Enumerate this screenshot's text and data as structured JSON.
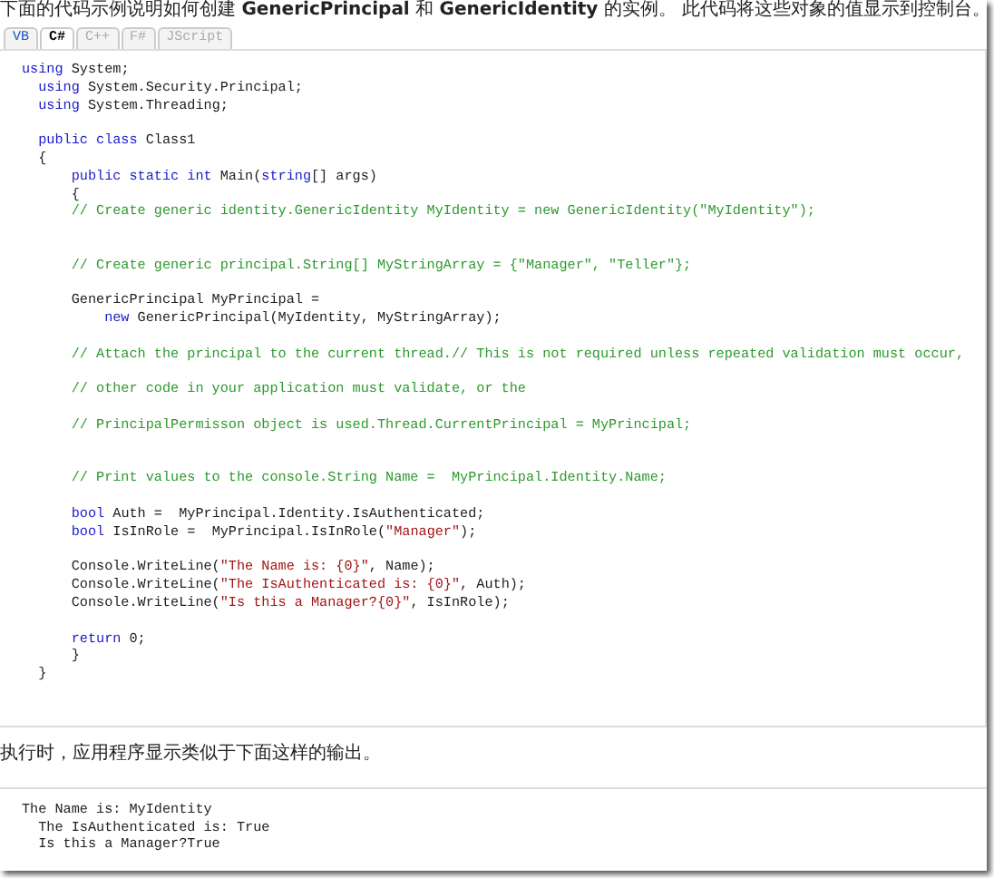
{
  "intro": "下面的代码示例说明如何创建 **GenericPrincipal** 和 **GenericIdentity** 的实例。 此代码将这些对象的值显示到控制台。",
  "tabs": [
    {
      "label": "VB",
      "selected": false,
      "disabled": false
    },
    {
      "label": "C#",
      "selected": true,
      "disabled": false
    },
    {
      "label": "C++",
      "selected": false,
      "disabled": true
    },
    {
      "label": "F#",
      "selected": false,
      "disabled": true
    },
    {
      "label": "JScript",
      "selected": false,
      "disabled": true
    }
  ],
  "code": [
    {
      "kind": "code",
      "segments": [
        {
          "kind": "keyword",
          "text": "using"
        },
        {
          "kind": "plain",
          "text": " System;"
        }
      ]
    },
    {
      "kind": "code",
      "segments": [
        {
          "kind": "keyword",
          "text": "  using"
        },
        {
          "kind": "plain",
          "text": " System.Security.Principal;"
        }
      ]
    },
    {
      "kind": "code",
      "segments": [
        {
          "kind": "keyword",
          "text": "  using"
        },
        {
          "kind": "plain",
          "text": " System.Threading;"
        }
      ]
    },
    {
      "kind": "blank"
    },
    {
      "kind": "code",
      "segments": [
        {
          "kind": "keyword",
          "text": "  public class"
        },
        {
          "kind": "plain",
          "text": " Class1"
        }
      ]
    },
    {
      "kind": "code",
      "segments": [
        {
          "kind": "plain",
          "text": "  {"
        }
      ]
    },
    {
      "kind": "code",
      "segments": [
        {
          "kind": "keyword",
          "text": "      public static int"
        },
        {
          "kind": "plain",
          "text": " Main("
        },
        {
          "kind": "keyword",
          "text": "string"
        },
        {
          "kind": "plain",
          "text": "[] args)"
        }
      ]
    },
    {
      "kind": "code",
      "segments": [
        {
          "kind": "plain",
          "text": "      {"
        }
      ]
    },
    {
      "kind": "code",
      "segments": [
        {
          "kind": "comment",
          "text": "      // Create generic identity.GenericIdentity MyIdentity = new GenericIdentity(\"MyIdentity\");"
        }
      ]
    },
    {
      "kind": "blank"
    },
    {
      "kind": "blank"
    },
    {
      "kind": "code",
      "segments": [
        {
          "kind": "comment",
          "text": "      // Create generic principal.String[] MyStringArray = {\"Manager\", \"Teller\"};"
        }
      ]
    },
    {
      "kind": "blank"
    },
    {
      "kind": "code",
      "segments": [
        {
          "kind": "plain",
          "text": "      GenericPrincipal MyPrincipal ="
        }
      ]
    },
    {
      "kind": "code",
      "segments": [
        {
          "kind": "keyword",
          "text": "          new"
        },
        {
          "kind": "plain",
          "text": " GenericPrincipal(MyIdentity, MyStringArray);"
        }
      ]
    },
    {
      "kind": "blank"
    },
    {
      "kind": "code",
      "segments": [
        {
          "kind": "comment",
          "text": "      // Attach the principal to the current thread.// This is not required unless repeated validation must occur,"
        }
      ]
    },
    {
      "kind": "blank"
    },
    {
      "kind": "code",
      "segments": [
        {
          "kind": "comment",
          "text": "      // other code in your application must validate, or the"
        }
      ]
    },
    {
      "kind": "blank"
    },
    {
      "kind": "code",
      "segments": [
        {
          "kind": "comment",
          "text": "      // PrincipalPermisson object is used.Thread.CurrentPrincipal = MyPrincipal;"
        }
      ]
    },
    {
      "kind": "blank"
    },
    {
      "kind": "blank"
    },
    {
      "kind": "code",
      "segments": [
        {
          "kind": "comment",
          "text": "      // Print values to the console.String Name =  MyPrincipal.Identity.Name;"
        }
      ]
    },
    {
      "kind": "blank"
    },
    {
      "kind": "code",
      "segments": [
        {
          "kind": "keyword",
          "text": "      bool"
        },
        {
          "kind": "plain",
          "text": " Auth =  MyPrincipal.Identity.IsAuthenticated;"
        }
      ]
    },
    {
      "kind": "code",
      "segments": [
        {
          "kind": "keyword",
          "text": "      bool"
        },
        {
          "kind": "plain",
          "text": " IsInRole =  MyPrincipal.IsInRole("
        },
        {
          "kind": "string",
          "text": "\"Manager\""
        },
        {
          "kind": "plain",
          "text": ");"
        }
      ]
    },
    {
      "kind": "blank"
    },
    {
      "kind": "code",
      "segments": [
        {
          "kind": "plain",
          "text": "      Console.WriteLine("
        },
        {
          "kind": "string",
          "text": "\"The Name is: {0}\""
        },
        {
          "kind": "plain",
          "text": ", Name);"
        }
      ]
    },
    {
      "kind": "code",
      "segments": [
        {
          "kind": "plain",
          "text": "      Console.WriteLine("
        },
        {
          "kind": "string",
          "text": "\"The IsAuthenticated is: {0}\""
        },
        {
          "kind": "plain",
          "text": ", Auth);"
        }
      ]
    },
    {
      "kind": "code",
      "segments": [
        {
          "kind": "plain",
          "text": "      Console.WriteLine("
        },
        {
          "kind": "string",
          "text": "\"Is this a Manager?{0}\""
        },
        {
          "kind": "plain",
          "text": ", IsInRole);"
        }
      ]
    },
    {
      "kind": "blank"
    },
    {
      "kind": "code",
      "segments": [
        {
          "kind": "keyword",
          "text": "      return"
        },
        {
          "kind": "plain",
          "text": " 0;"
        }
      ]
    },
    {
      "kind": "code",
      "segments": [
        {
          "kind": "plain",
          "text": "      }"
        }
      ]
    },
    {
      "kind": "code",
      "segments": [
        {
          "kind": "plain",
          "text": "  }"
        }
      ]
    }
  ],
  "output_intro": "执行时，应用程序显示类似于下面这样的输出。",
  "output": [
    "The Name is: MyIdentity",
    "  The IsAuthenticated is: True",
    "  Is this a Manager?True"
  ]
}
